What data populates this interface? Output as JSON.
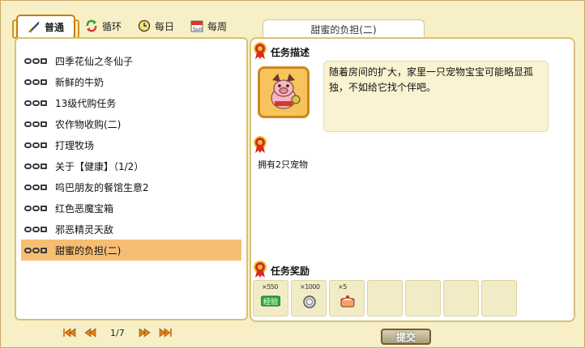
{
  "tabs": [
    {
      "label": "普通",
      "icon": "sword-icon",
      "active": true
    },
    {
      "label": "循环",
      "icon": "cycle-icon",
      "active": false
    },
    {
      "label": "每日",
      "icon": "clock-icon",
      "active": false
    },
    {
      "label": "每周",
      "icon": "calendar-icon",
      "active": false,
      "badge": "Sun"
    }
  ],
  "quests": [
    "四季花仙之冬仙子",
    "新鲜的牛奶",
    "13级代购任务",
    "农作物收购(二)",
    "打理牧场",
    "关于【健康】（1/2）",
    "呜巴朋友的餐馆生意2",
    "红色恶魔宝箱",
    "邪恶精灵天敌",
    "甜蜜的负担(二)"
  ],
  "selected_index": 9,
  "pager": {
    "text": "1/7"
  },
  "detail": {
    "tab_title": "甜蜜的负担(二)",
    "desc_title": "任务描述",
    "desc_text": "随着房间的扩大，家里一只宠物宝宝可能略显孤独，不如给它找个伴吧。",
    "condition": "拥有2只宠物",
    "reward_title": "任务奖励",
    "rewards": [
      {
        "count": "×550",
        "icon": "exp-icon",
        "label": "经验"
      },
      {
        "count": "×1000",
        "icon": "coin-icon"
      },
      {
        "count": "×5",
        "icon": "cake-icon"
      },
      {},
      {},
      {},
      {}
    ]
  },
  "submit_label": "提交",
  "colors": {
    "accent": "#f6be73",
    "frame": "#d9c07a",
    "medal": "#d62b1e"
  }
}
